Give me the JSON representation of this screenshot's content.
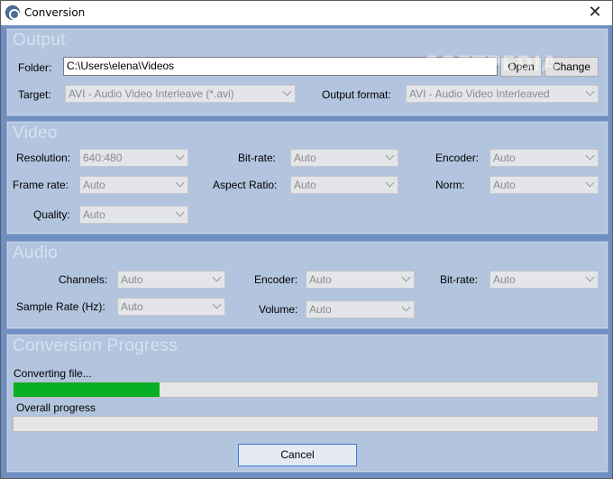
{
  "window": {
    "title": "Conversion",
    "close_glyph": "✕",
    "icon": "app-logo-icon"
  },
  "watermark": "SOFTPEDIA",
  "output": {
    "title": "Output",
    "folder_label": "Folder:",
    "folder_value": "C:\\Users\\elena\\Videos",
    "open_label": "Open",
    "change_label": "Change",
    "target_label": "Target:",
    "target_value": "AVI - Audio Video Interleave (*.avi)",
    "format_label": "Output format:",
    "format_value": "AVI - Audio Video Interleaved"
  },
  "video": {
    "title": "Video",
    "resolution_label": "Resolution:",
    "resolution_value": "640:480",
    "bitrate_label": "Bit-rate:",
    "bitrate_value": "Auto",
    "encoder_label": "Encoder:",
    "encoder_value": "Auto",
    "framerate_label": "Frame rate:",
    "framerate_value": "Auto",
    "aspect_label": "Aspect Ratio:",
    "aspect_value": "Auto",
    "norm_label": "Norm:",
    "norm_value": "Auto",
    "quality_label": "Quality:",
    "quality_value": "Auto"
  },
  "audio": {
    "title": "Audio",
    "channels_label": "Channels:",
    "channels_value": "Auto",
    "encoder_label": "Encoder:",
    "encoder_value": "Auto",
    "bitrate_label": "Bit-rate:",
    "bitrate_value": "Auto",
    "samplerate_label": "Sample Rate (Hz):",
    "samplerate_value": "Auto",
    "volume_label": "Volume:",
    "volume_value": "Auto"
  },
  "progress": {
    "title": "Conversion Progress",
    "file_label": "Converting file...",
    "file_fraction": 0.25,
    "overall_label": "Overall progress",
    "overall_fraction": 0.0,
    "fill_color": "#06b025"
  },
  "cancel_label": "Cancel"
}
